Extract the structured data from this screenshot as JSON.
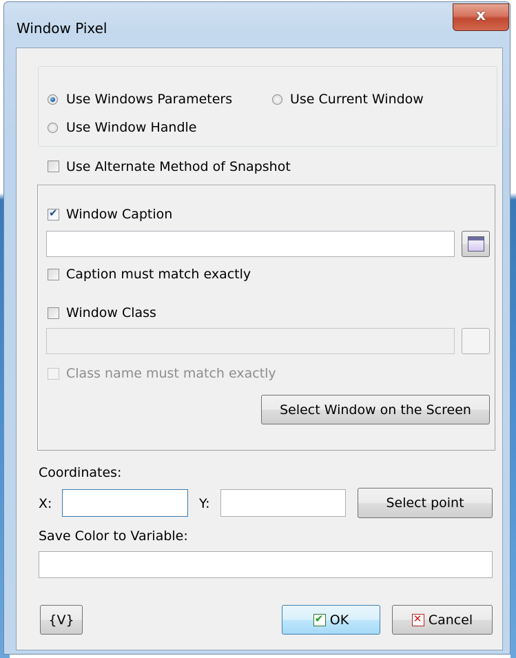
{
  "window": {
    "title": "Window Pixel",
    "close_glyph": "x"
  },
  "mode": {
    "use_windows_parameters": "Use Windows Parameters",
    "use_current_window": "Use Current Window",
    "use_window_handle": "Use Window Handle",
    "selected": "use_windows_parameters"
  },
  "alternate_snapshot": {
    "label": "Use Alternate Method of Snapshot",
    "checked": false
  },
  "caption": {
    "label": "Window Caption",
    "checked": true,
    "value": "",
    "exact_label": "Caption must match exactly",
    "exact_checked": false
  },
  "class": {
    "label": "Window Class",
    "checked": false,
    "value": "",
    "exact_label": "Class name must match exactly",
    "exact_checked": false
  },
  "select_window_button": "Select Window on the Screen",
  "coordinates": {
    "label": "Coordinates:",
    "x_label": "X:",
    "y_label": "Y:",
    "x_value": "",
    "y_value": ""
  },
  "select_point_button": "Select point",
  "save_color": {
    "label": "Save Color to Variable:",
    "value": ""
  },
  "footer": {
    "variables_button": "{V}",
    "ok_button": "OK",
    "cancel_button": "Cancel"
  },
  "icons": {
    "caption_picker": "window-picker-icon",
    "ok": "checkmark-icon",
    "cancel": "x-icon",
    "close": "close-icon"
  }
}
